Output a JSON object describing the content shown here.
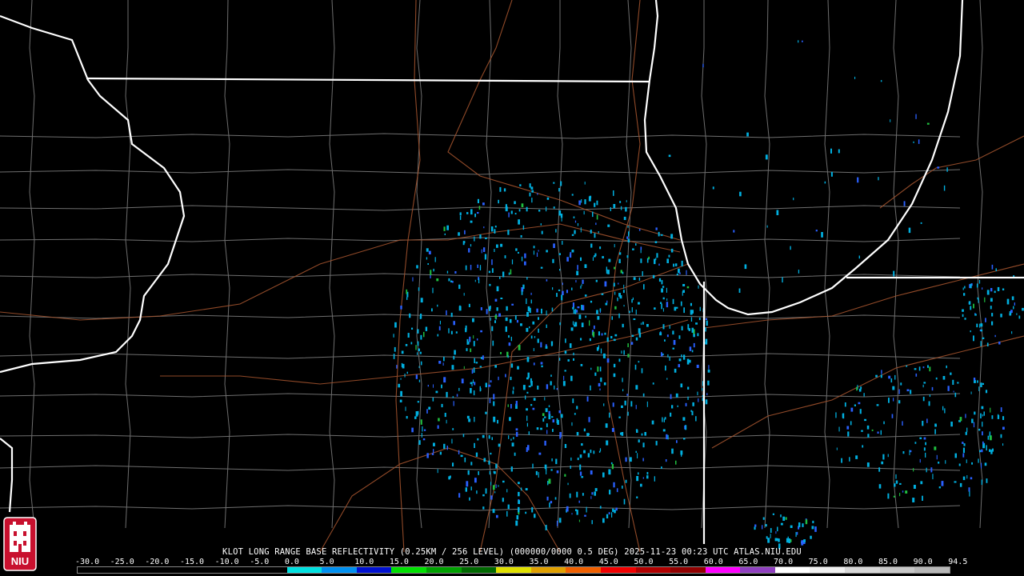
{
  "caption": "KLOT LONG RANGE BASE REFLECTIVITY (0.25KM / 256 LEVEL) (000000/0000 0.5 DEG) 2025-11-23 00:23 UTC  ATLAS.NIU.EDU",
  "logo_text": "NIU",
  "scale_labels": [
    "-30.0",
    "-25.0",
    "-20.0",
    "-15.0",
    "-10.0",
    "-5.0",
    "0.0",
    "5.0",
    "10.0",
    "15.0",
    "20.0",
    "25.0",
    "30.0",
    "35.0",
    "40.0",
    "45.0",
    "50.0",
    "55.0",
    "60.0",
    "65.0",
    "70.0",
    "75.0",
    "80.0",
    "85.0",
    "90.0",
    "94.5"
  ],
  "scale_colors": [
    "#000000",
    "#000000",
    "#000000",
    "#000000",
    "#000000",
    "#000000",
    "#00e0e0",
    "#0090f0",
    "#0010d0",
    "#00e000",
    "#00a000",
    "#006800",
    "#e0e000",
    "#e0a000",
    "#f06000",
    "#f00000",
    "#b00000",
    "#900000",
    "#ff00ff",
    "#9040c0",
    "#ffffff",
    "#f0f0f0",
    "#d8d8d8",
    "#c8c8c8",
    "#b8b8b8"
  ],
  "colors": {
    "background": "#000000",
    "state_border": "#ffffff",
    "county_border": "#777777",
    "highway": "#a0522d",
    "echo_light": "#00b0e0",
    "echo_moderate": "#2a60ff",
    "echo_green": "#20c040"
  }
}
